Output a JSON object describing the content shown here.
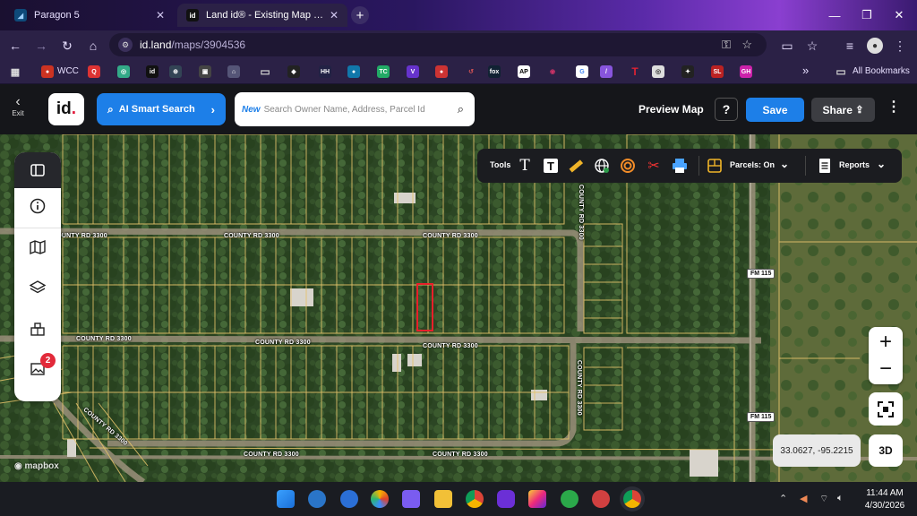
{
  "browser": {
    "tabs": [
      {
        "title": "Paragon 5",
        "active": false
      },
      {
        "title": "Land id® - Existing Map Edit",
        "active": true
      }
    ],
    "url_host": "id.land",
    "url_path": "/maps/3904536",
    "bookmarks": {
      "wcc_label": "WCC",
      "all_bookmarks": "All Bookmarks",
      "more": "»"
    }
  },
  "app": {
    "exit_label": "Exit",
    "logo_text": "id",
    "ai_search_label": "AI Smart Search",
    "search_new_tag": "New",
    "search_placeholder": "Search Owner Name, Address, Parcel Id",
    "preview_map": "Preview Map",
    "help": "?",
    "save": "Save",
    "share": "Share"
  },
  "toolbar": {
    "tools_label": "Tools",
    "parcels_label": "Parcels: On",
    "reports_label": "Reports"
  },
  "map": {
    "road_labels": {
      "r1": "COUNTY RD 3300",
      "r2": "COUNTY RD 3300",
      "r3": "COUNTY RD 3300",
      "r4": "COUNTY RD 3300",
      "r5": "COUNTY RD 3300",
      "r6": "COUNTY RD 3300",
      "r7": "COUNTY RD 3300",
      "r8": "COUNTY RD 3300",
      "r9": "COUNTY RD 3300",
      "r10": "COUNTY RD 3300",
      "r11": "COUNTY RD 3300"
    },
    "fm_labels": {
      "f1": "FM 115",
      "f2": "FM 115"
    },
    "coordinates": "33.0627, -95.2215",
    "btn_3d": "3D",
    "attribution": "mapbox",
    "layers_badge": "2",
    "zoom_in": "+",
    "zoom_out": "−"
  },
  "taskbar": {
    "time": "11:44 AM",
    "date": "4/30/2026"
  },
  "colors": {
    "accent_blue": "#1d7fe8",
    "parcel_line": "#e5c36a",
    "selected_parcel": "#e8202a"
  }
}
